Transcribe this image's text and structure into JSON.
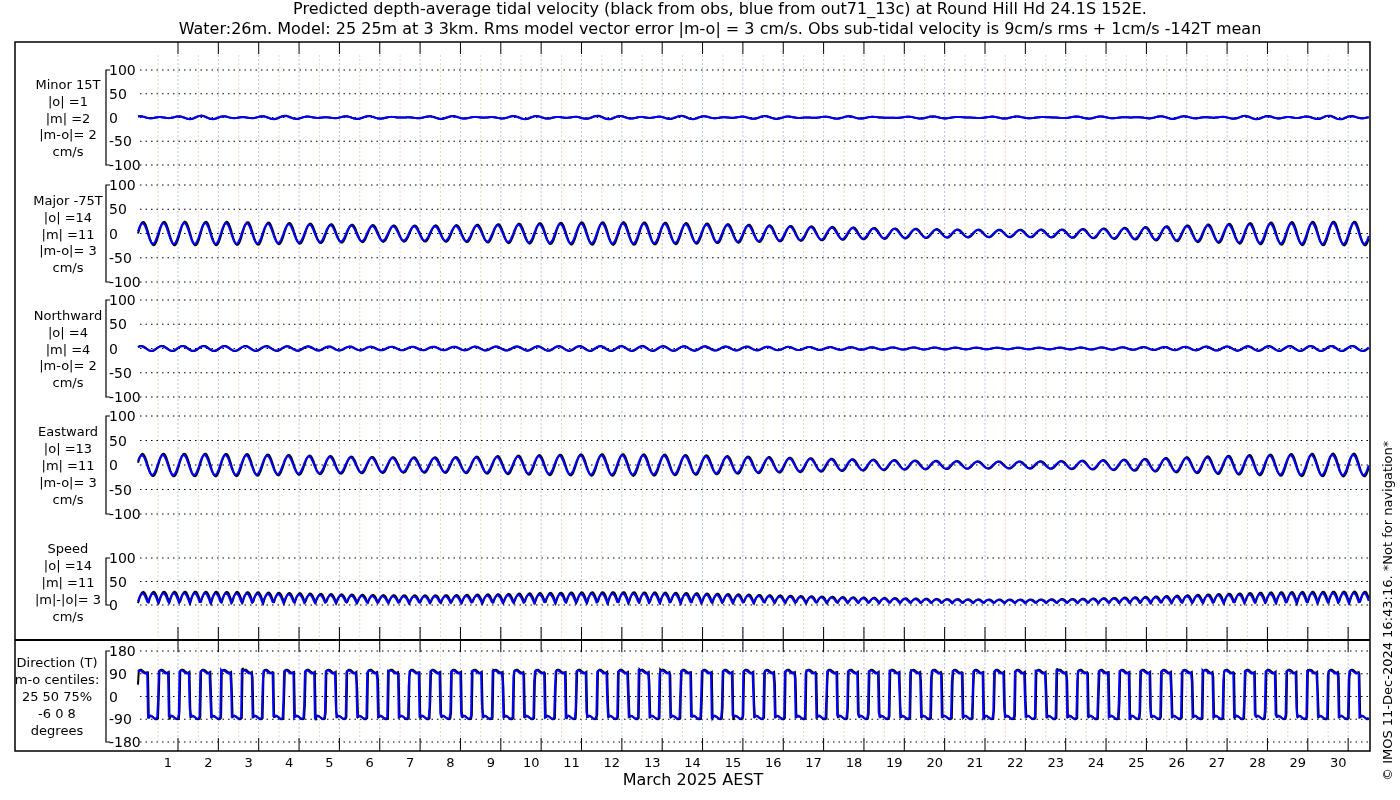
{
  "title_lines": [
    "Predicted depth-average tidal velocity (black from obs, blue from out71_13c) at Round Hill Hd 24.1S 152E.",
    "Water:26m. Model: 25 25m at 3 3km. Rms model vector error |m-o| = 3 cm/s. Obs sub-tidal velocity is 9cm/s rms + 1cm/s -142T mean"
  ],
  "panels": [
    {
      "kind": "velocity",
      "label_lines": [
        "Minor 15T",
        "|o| =1",
        "|m| =2",
        "|m-o|= 2",
        "cm/s"
      ],
      "yticks": [
        "100",
        "50",
        "0",
        "-50",
        "-100"
      ]
    },
    {
      "kind": "velocity",
      "label_lines": [
        "Major -75T",
        "|o| =14",
        "|m| =11",
        "|m-o|= 3",
        "cm/s"
      ],
      "yticks": [
        "100",
        "50",
        "0",
        "-50",
        "-100"
      ]
    },
    {
      "kind": "velocity",
      "label_lines": [
        "Northward",
        "|o| =4",
        "|m| =4",
        "|m-o|= 2",
        "cm/s"
      ],
      "yticks": [
        "100",
        "50",
        "0",
        "-50",
        "-100"
      ]
    },
    {
      "kind": "velocity",
      "label_lines": [
        "Eastward",
        "|o| =13",
        "|m| =11",
        "|m-o|= 3",
        "cm/s"
      ],
      "yticks": [
        "100",
        "50",
        "0",
        "-50",
        "-100"
      ]
    },
    {
      "kind": "speed",
      "label_lines": [
        "Speed",
        "|o| =14",
        "|m| =11",
        "|m|-|o|= 3",
        "cm/s"
      ],
      "yticks": [
        "100",
        "50",
        "0"
      ]
    },
    {
      "kind": "direction",
      "label_lines": [
        "Direction (T)",
        "m-o centiles:",
        "25  50  75%",
        "-6  0  8",
        "degrees"
      ],
      "yticks": [
        "180",
        "90",
        "0",
        "-90",
        "-180"
      ]
    }
  ],
  "x_axis": {
    "ticks": [
      "1",
      "2",
      "3",
      "4",
      "5",
      "6",
      "7",
      "8",
      "9",
      "10",
      "11",
      "12",
      "13",
      "14",
      "15",
      "16",
      "17",
      "18",
      "19",
      "20",
      "21",
      "22",
      "23",
      "24",
      "25",
      "26",
      "27",
      "28",
      "29",
      "30"
    ],
    "label": "March 2025 AEST"
  },
  "credit": "© IMOS 11-Dec-2024 16:43:16.  *Not for navigation*"
}
